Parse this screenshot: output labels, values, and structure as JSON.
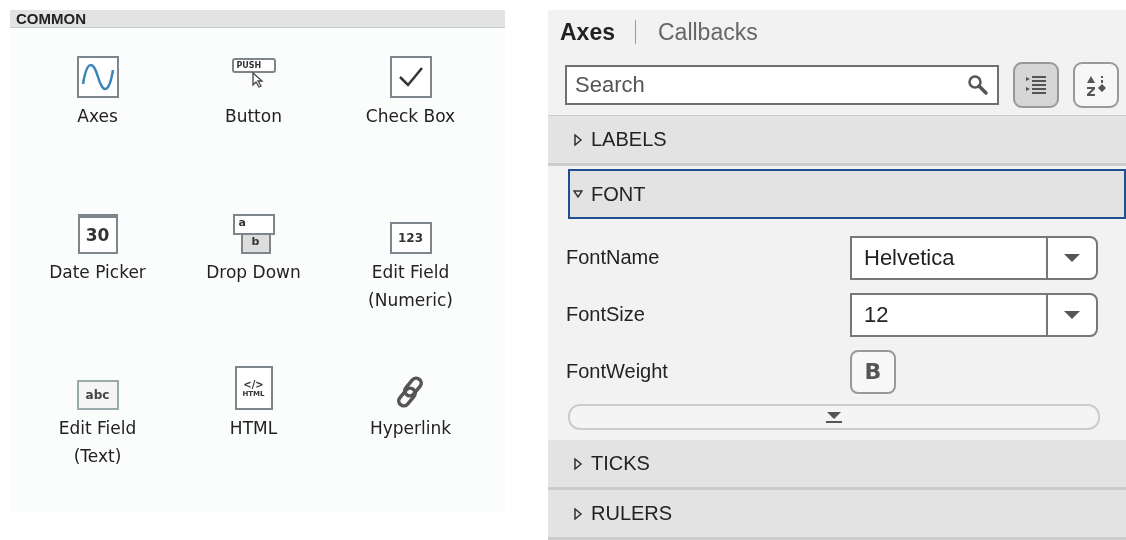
{
  "library": {
    "title": "COMMON",
    "components": [
      {
        "kind": "axes",
        "label": "Axes"
      },
      {
        "kind": "button",
        "label": "Button",
        "icon_text": "PUSH"
      },
      {
        "kind": "checkbox",
        "label": "Check Box"
      },
      {
        "kind": "datepicker",
        "label": "Date Picker",
        "icon_text": "30"
      },
      {
        "kind": "dropdown",
        "label": "Drop Down",
        "icon_text": "a",
        "icon_text_2": "b"
      },
      {
        "kind": "numeric",
        "label": "Edit Field (Numeric)",
        "icon_text": "123"
      },
      {
        "kind": "text",
        "label": "Edit Field (Text)",
        "icon_text": "abc"
      },
      {
        "kind": "html",
        "label": "HTML",
        "icon_text": "</>",
        "icon_text_2": "HTML"
      },
      {
        "kind": "hyperlink",
        "label": "Hyperlink"
      }
    ]
  },
  "inspector": {
    "tabs": [
      {
        "label": "Axes",
        "selected": true
      },
      {
        "label": "Callbacks",
        "selected": false
      }
    ],
    "search": {
      "placeholder": "Search"
    },
    "view_buttons": [
      {
        "kind": "grouped",
        "selected": true
      },
      {
        "kind": "alphabetical",
        "selected": false
      }
    ],
    "sections": [
      {
        "title": "LABELS",
        "expanded": false
      },
      {
        "title": "FONT",
        "expanded": true,
        "focused": true,
        "properties": [
          {
            "kind": "dropdown",
            "name": "FontName",
            "value": "Helvetica"
          },
          {
            "kind": "dropdown",
            "name": "FontSize",
            "value": "12"
          },
          {
            "kind": "toggle",
            "name": "FontWeight",
            "value": "B"
          }
        ]
      },
      {
        "title": "TICKS",
        "expanded": false
      },
      {
        "title": "RULERS",
        "expanded": false
      }
    ]
  }
}
